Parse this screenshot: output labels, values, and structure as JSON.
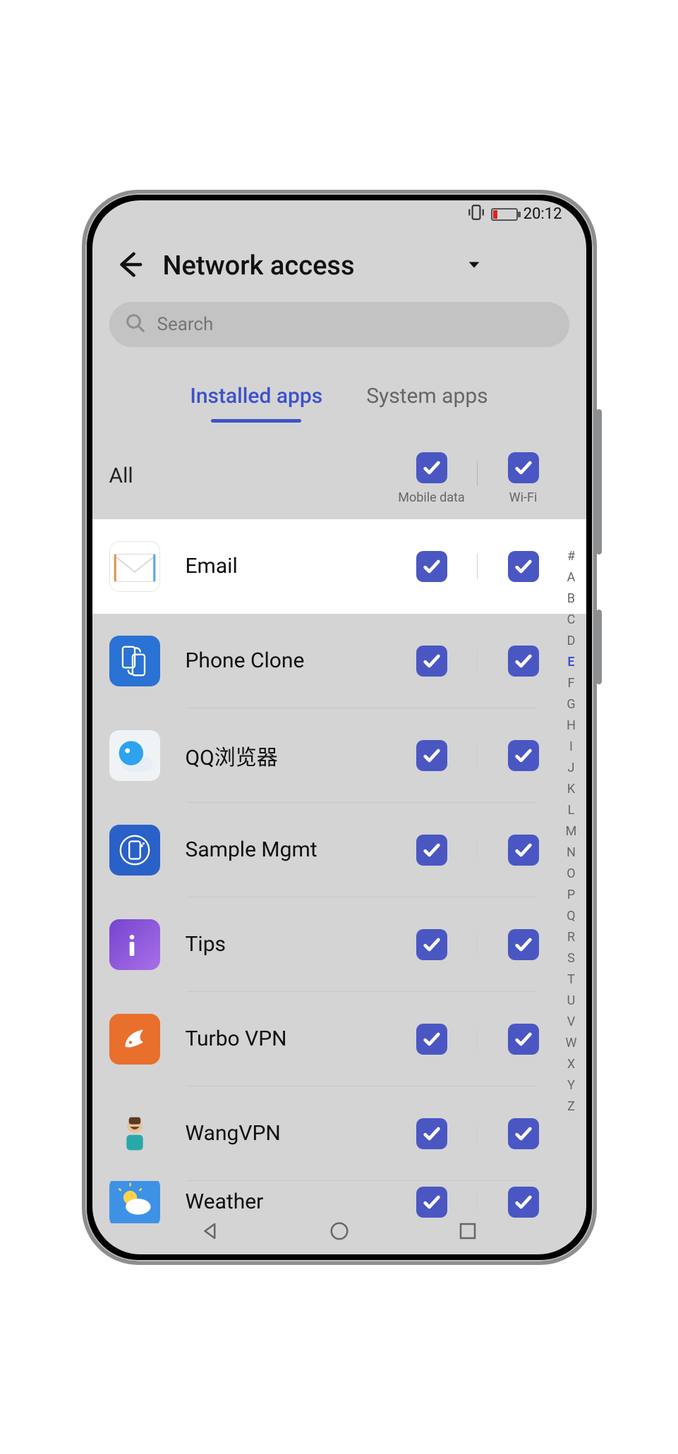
{
  "status": {
    "time": "20:12"
  },
  "header": {
    "title": "Network access"
  },
  "search": {
    "placeholder": "Search"
  },
  "tabs": {
    "installed": "Installed apps",
    "system": "System apps",
    "active": "installed"
  },
  "columns": {
    "all": "All",
    "mobile": "Mobile data",
    "wifi": "Wi-Fi"
  },
  "apps": [
    {
      "name": "Email",
      "icon": "email",
      "mobile": true,
      "wifi": true,
      "highlight": true
    },
    {
      "name": "Phone Clone",
      "icon": "phoneclone",
      "mobile": true,
      "wifi": true
    },
    {
      "name": "QQ浏览器",
      "icon": "qq",
      "mobile": true,
      "wifi": true
    },
    {
      "name": "Sample Mgmt",
      "icon": "sample",
      "mobile": true,
      "wifi": true
    },
    {
      "name": "Tips",
      "icon": "tips",
      "mobile": true,
      "wifi": true
    },
    {
      "name": "Turbo VPN",
      "icon": "turbo",
      "mobile": true,
      "wifi": true
    },
    {
      "name": "WangVPN",
      "icon": "wang",
      "mobile": true,
      "wifi": true
    },
    {
      "name": "Weather",
      "icon": "weather",
      "mobile": true,
      "wifi": true,
      "partial": true
    }
  ],
  "alpha_index": [
    "#",
    "A",
    "B",
    "C",
    "D",
    "E",
    "F",
    "G",
    "H",
    "I",
    "J",
    "K",
    "L",
    "M",
    "N",
    "O",
    "P",
    "Q",
    "R",
    "S",
    "T",
    "U",
    "V",
    "W",
    "X",
    "Y",
    "Z"
  ],
  "alpha_active": "E",
  "colors": {
    "accent": "#3d52c9",
    "checkbox": "#4a57c3"
  }
}
